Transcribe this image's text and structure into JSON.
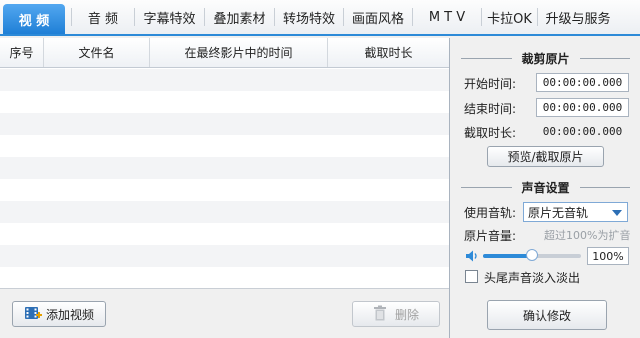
{
  "tabs": [
    {
      "label": "视 频",
      "active": true
    },
    {
      "label": "音 频",
      "active": false
    },
    {
      "label": "字幕特效",
      "active": false
    },
    {
      "label": "叠加素材",
      "active": false
    },
    {
      "label": "转场特效",
      "active": false
    },
    {
      "label": "画面风格",
      "active": false
    },
    {
      "label": "M T V",
      "active": false
    },
    {
      "label": "卡拉OK",
      "active": false
    },
    {
      "label": "升级与服务",
      "active": false
    }
  ],
  "table": {
    "columns": [
      "序号",
      "文件名",
      "在最终影片中的时间",
      "截取时长"
    ]
  },
  "left_buttons": {
    "add_video": "添加视频",
    "delete": "删除"
  },
  "crop": {
    "title": "裁剪原片",
    "start_label": "开始时间:",
    "start_value": "00:00:00.000",
    "end_label": "结束时间:",
    "end_value": "00:00:00.000",
    "duration_label": "截取时长:",
    "duration_value": "00:00:00.000",
    "preview_button": "预览/截取原片"
  },
  "audio": {
    "title": "声音设置",
    "track_label": "使用音轨:",
    "track_value": "原片无音轨",
    "volume_label": "原片音量:",
    "volume_hint": "超过100%为扩音",
    "volume_level": 0.5,
    "volume_value": "100%",
    "fade_label": "头尾声音淡入淡出",
    "fade_checked": false
  },
  "confirm_button": "确认修改",
  "colors": {
    "accent": "#2d8ad8",
    "active_tab": "#1f7fd6"
  },
  "icons": {
    "add_video": "film-plus-icon",
    "delete": "trash-icon",
    "volume": "speaker-icon",
    "dropdown": "chevron-down-icon"
  }
}
